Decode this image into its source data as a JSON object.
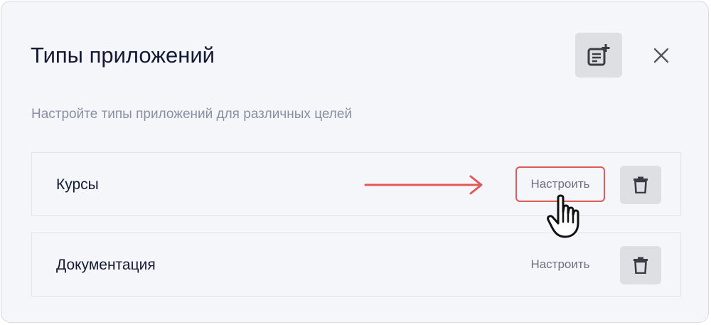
{
  "dialog": {
    "title": "Типы приложений",
    "subtitle": "Настройте типы приложений для различных целей",
    "add_icon": "add-note-icon",
    "close_icon": "close-icon"
  },
  "rows": [
    {
      "label": "Курсы",
      "configure_label": "Настроить",
      "delete_icon": "trash-icon",
      "highlighted": true
    },
    {
      "label": "Документация",
      "configure_label": "Настроить",
      "delete_icon": "trash-icon",
      "highlighted": false
    }
  ],
  "annotation": {
    "arrow_color": "#e05a5a",
    "pointer_icon": "hand-pointer-icon"
  }
}
